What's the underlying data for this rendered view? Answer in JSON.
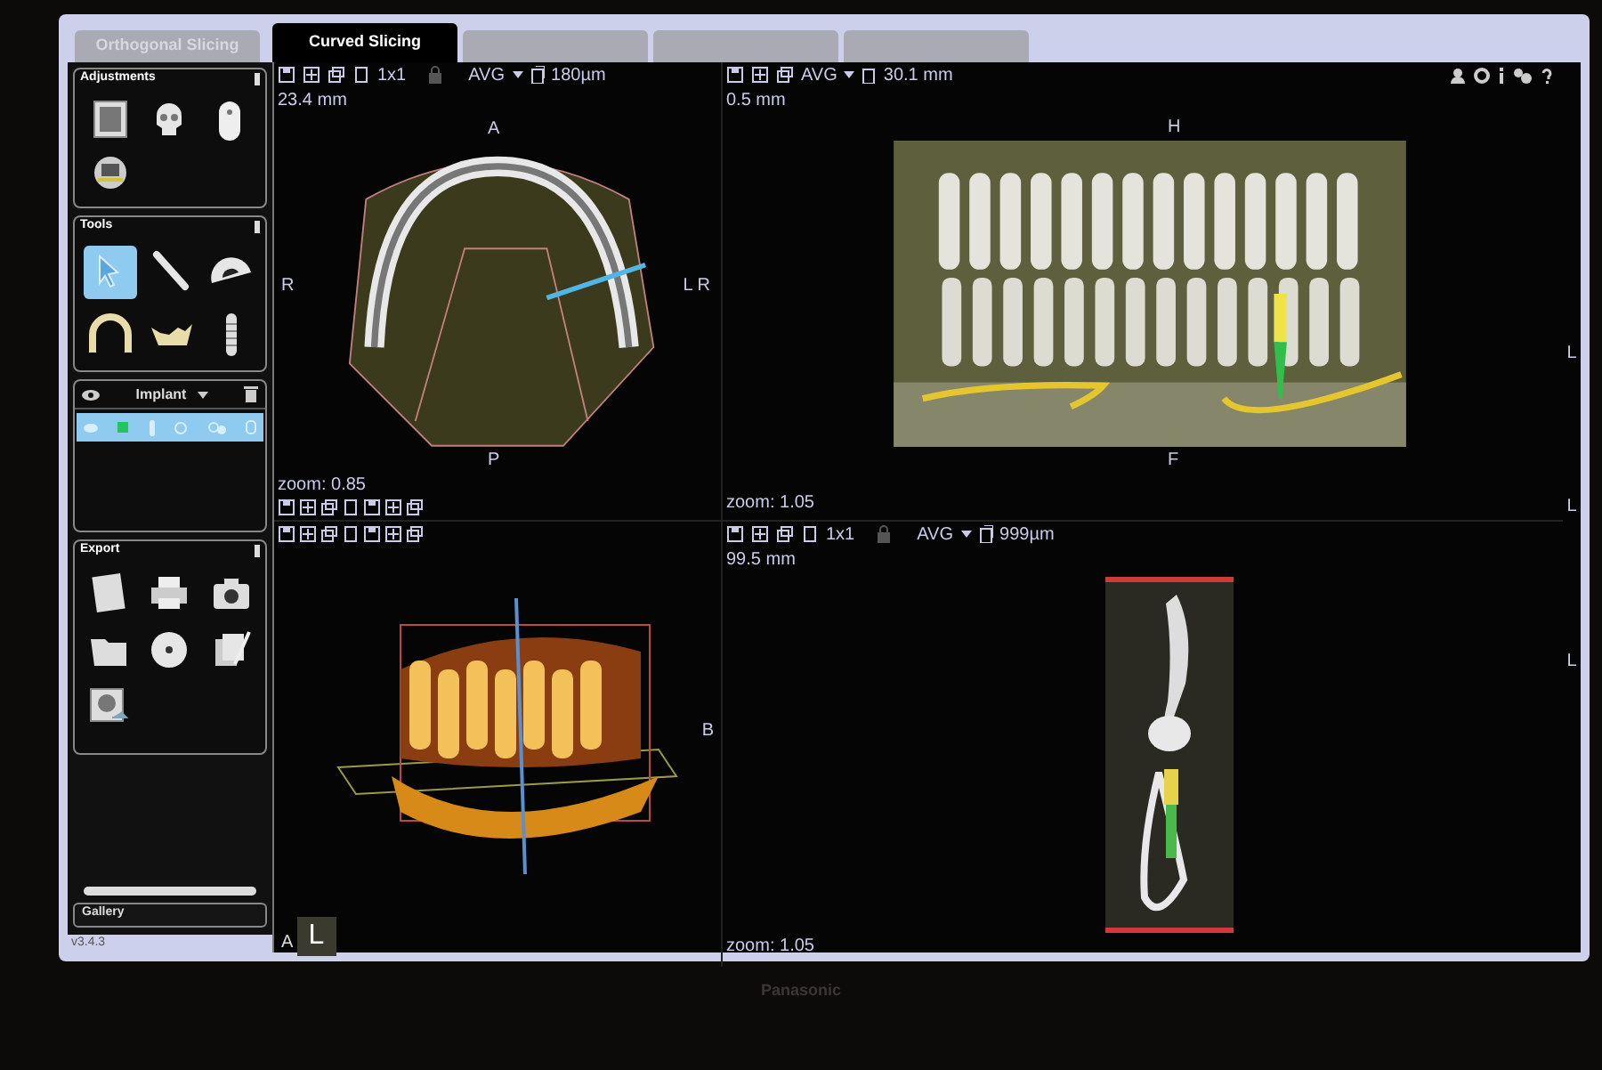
{
  "tabs": [
    {
      "label": "Orthogonal Slicing",
      "selected": false
    },
    {
      "label": "Curved Slicing",
      "selected": true
    },
    {
      "selected": false
    },
    {
      "selected": false
    },
    {
      "selected": false
    }
  ],
  "sidebar": {
    "adjustments": {
      "title": "Adjustments"
    },
    "tools": {
      "title": "Tools",
      "items": [
        {
          "kind": "pointer",
          "selected": true
        },
        {
          "kind": "ruler",
          "selected": false
        },
        {
          "kind": "protractor",
          "selected": false
        },
        {
          "kind": "arch",
          "selected": false
        },
        {
          "kind": "mandible",
          "selected": false
        },
        {
          "kind": "implant",
          "selected": false
        }
      ]
    },
    "implants": {
      "header": "Implant",
      "rows": [
        {
          "selected": true,
          "color": "#22c55e"
        }
      ]
    },
    "export": {
      "title": "Export"
    },
    "gallery": {
      "title": "Gallery"
    },
    "version": "v3.4.3"
  },
  "views": {
    "axial": {
      "grid": "1x1",
      "filter": "AVG",
      "thickness": "180µm",
      "depth": "23.4 mm",
      "top": "A",
      "bottom": "P",
      "left": "R",
      "right": [
        "L",
        "R"
      ],
      "zoom": "zoom: 0.85"
    },
    "panoramic": {
      "filter": "AVG",
      "thickness": "30.1 mm",
      "depth": "0.5 mm",
      "top": "H",
      "bottom": "F",
      "zoom": "zoom: 1.05"
    },
    "render_3d": {
      "side": "B",
      "cube": [
        "A",
        "L"
      ]
    },
    "cross_section": {
      "grid": "1x1",
      "filter": "AVG",
      "thickness": "999µm",
      "depth": "99.5 mm",
      "zoom": "zoom: 1.05"
    }
  },
  "edge_labels": [
    "L",
    "L",
    "L"
  ],
  "bezel": {
    "brand": "Panasonic"
  }
}
